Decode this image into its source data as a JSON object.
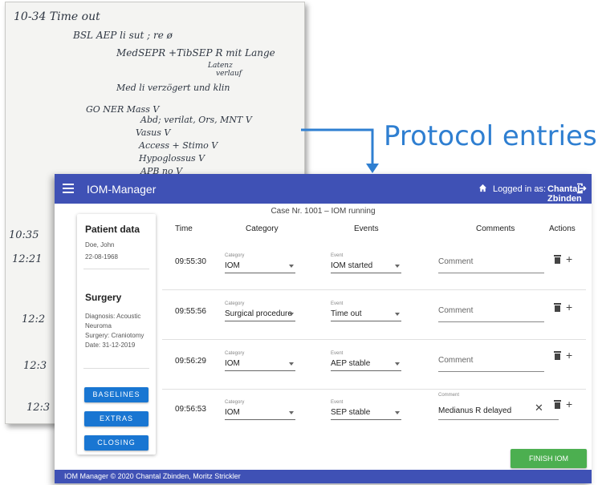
{
  "notes": {
    "lines": [
      "10-34  Time out",
      "BSL  AEP li sut ; re ø",
      "MedSEPR +TibSEP R mit Lange",
      "Latenz",
      "verlauf",
      "Med li  verzögert und klin",
      "GO NER  Mass V",
      "Abd; verilat, Ors, MNT V",
      "Vasus V",
      "Access + Stimo V",
      "Hypoglossus V",
      "APB no V"
    ],
    "margin_times": [
      "10:35",
      "12:21",
      "12:2",
      "12:3",
      "12:3",
      "12:3"
    ]
  },
  "callout": {
    "text": "Protocol entries",
    "color": "#2f7fd1"
  },
  "app": {
    "title": "IOM-Manager",
    "logged_in_label": "Logged in as:",
    "user_name": "Chantal Zbinden",
    "case_text": "Case Nr. 1001 – IOM running",
    "colors": {
      "primary": "#3f51b5",
      "button": "#1976d2",
      "finish": "#4caf50"
    }
  },
  "sidebar": {
    "patient_title": "Patient data",
    "patient_name": "Doe, John",
    "patient_dob": "22-08-1968",
    "surgery_title": "Surgery",
    "diagnosis_line1": "Diagnosis: Acoustic",
    "diagnosis_line2": "Neuroma",
    "surgery_line": "Surgery: Craniotomy",
    "date_line": "Date: 31-12-2019",
    "buttons": [
      "BASELINES",
      "EXTRAS",
      "CLOSING"
    ]
  },
  "table": {
    "headers": {
      "time": "Time",
      "category": "Category",
      "events": "Events",
      "comments": "Comments",
      "actions": "Actions"
    },
    "category_label": "Category",
    "event_label": "Event",
    "comment_label": "Comment",
    "rows": [
      {
        "time": "09:55:30",
        "category": "IOM",
        "event": "IOM started",
        "comment": ""
      },
      {
        "time": "09:55:56",
        "category": "Surgical procedure",
        "event": "Time out",
        "comment": ""
      },
      {
        "time": "09:56:29",
        "category": "IOM",
        "event": "AEP stable",
        "comment": ""
      },
      {
        "time": "09:56:53",
        "category": "IOM",
        "event": "SEP stable",
        "comment": "Medianus R delayed"
      }
    ]
  },
  "finish_label": "FINISH IOM",
  "footer": "IOM Manager © 2020 Chantal Zbinden, Moritz Strickler"
}
